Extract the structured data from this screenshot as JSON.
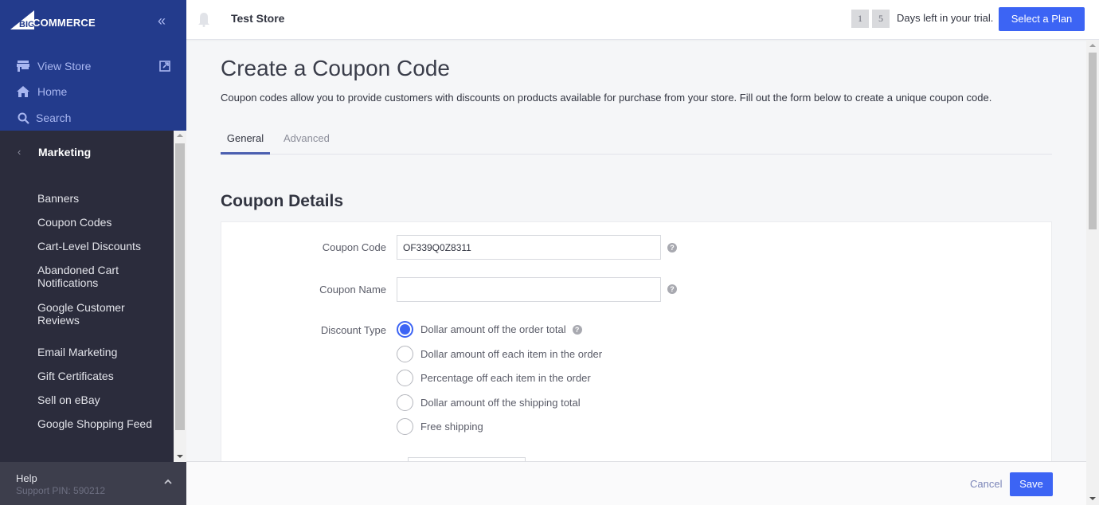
{
  "brand": {
    "logo_text": "COMMERCE",
    "logo_prefix": "BIG",
    "colors": {
      "sidebar_top": "#233b8c",
      "sidebar": "#2b2c3c",
      "primary": "#3c64f4",
      "tab_underline": "#4b5fb0"
    }
  },
  "sidebar": {
    "collapse_icon": "double-chevron-left-icon",
    "top_links": [
      {
        "label": "View Store",
        "icon": "store-icon",
        "external_icon": "external-link-icon"
      },
      {
        "label": "Home",
        "icon": "home-icon"
      },
      {
        "label": "Search",
        "icon": "search-icon"
      }
    ],
    "section": {
      "title": "Marketing",
      "back_icon": "chevron-left-icon"
    },
    "items": [
      {
        "label": "Banners"
      },
      {
        "label": "Coupon Codes"
      },
      {
        "label": "Cart-Level Discounts"
      },
      {
        "label": "Abandoned Cart Notifications"
      },
      {
        "label": "Google Customer Reviews"
      },
      {
        "label": "Email Marketing"
      },
      {
        "label": "Gift Certificates"
      },
      {
        "label": "Sell on eBay"
      },
      {
        "label": "Google Shopping Feed"
      }
    ],
    "help": {
      "title": "Help",
      "support_pin": "Support PIN: 590212",
      "toggle_icon": "chevron-up-icon"
    }
  },
  "header": {
    "store_name": "Test Store",
    "trial_days": [
      "1",
      "5"
    ],
    "trial_text": "Days left in your trial.",
    "select_plan": "Select a Plan"
  },
  "page": {
    "title": "Create a Coupon Code",
    "description": "Coupon codes allow you to provide customers with discounts on products available for purchase from your store. Fill out the form below to create a unique coupon code.",
    "tabs": [
      {
        "label": "General",
        "active": true
      },
      {
        "label": "Advanced",
        "active": false
      }
    ],
    "section_title": "Coupon Details",
    "form": {
      "coupon_code": {
        "label": "Coupon Code",
        "value": "OF339Q0Z8311"
      },
      "coupon_name": {
        "label": "Coupon Name",
        "value": "",
        "placeholder": ""
      },
      "discount_type": {
        "label": "Discount Type",
        "selected": 0,
        "options": [
          "Dollar amount off the order total",
          "Dollar amount off each item in the order",
          "Percentage off each item in the order",
          "Dollar amount off the shipping total",
          "Free shipping"
        ]
      }
    }
  },
  "footer": {
    "cancel": "Cancel",
    "save": "Save"
  }
}
